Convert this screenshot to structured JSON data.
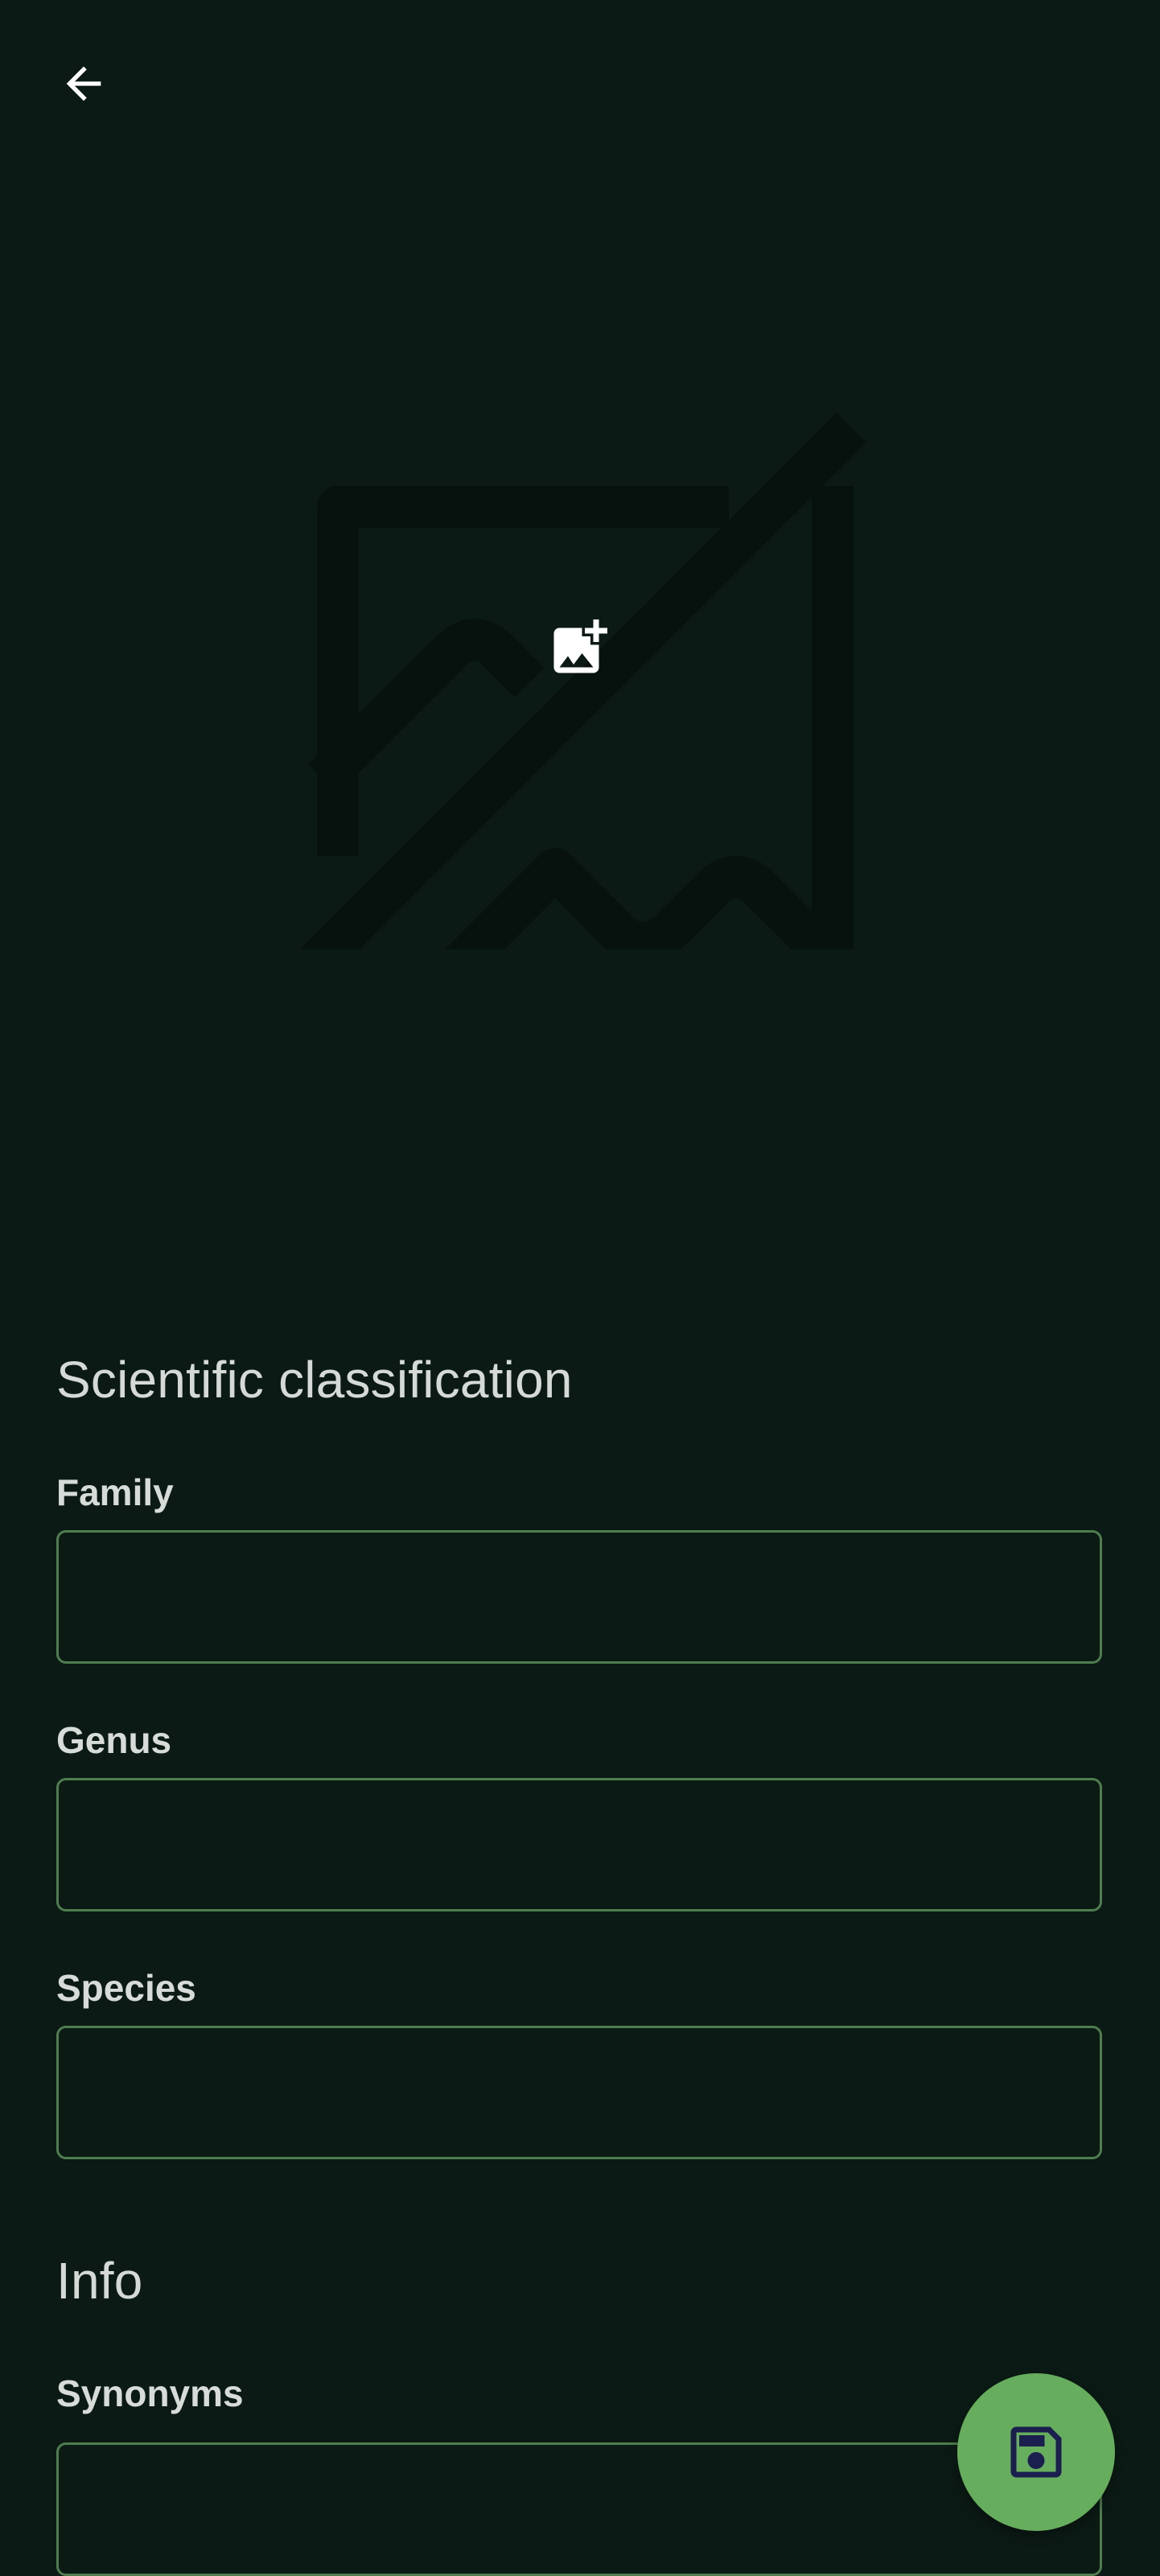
{
  "header": {
    "back_icon": "arrow-left-icon"
  },
  "image": {
    "placeholder_icon": "image-off-icon",
    "add_icon": "add-photo-icon"
  },
  "classification": {
    "title": "Scientific classification",
    "fields": [
      {
        "label": "Family",
        "value": ""
      },
      {
        "label": "Genus",
        "value": ""
      },
      {
        "label": "Species",
        "value": ""
      }
    ]
  },
  "info": {
    "title": "Info",
    "fields": [
      {
        "label": "Synonyms",
        "value": ""
      }
    ]
  },
  "fab": {
    "icon": "save-icon"
  },
  "colors": {
    "background": "#0b1a15",
    "input_border": "#4f7d4f",
    "fab": "#67ad5e",
    "fab_icon": "#1b1f4f"
  }
}
